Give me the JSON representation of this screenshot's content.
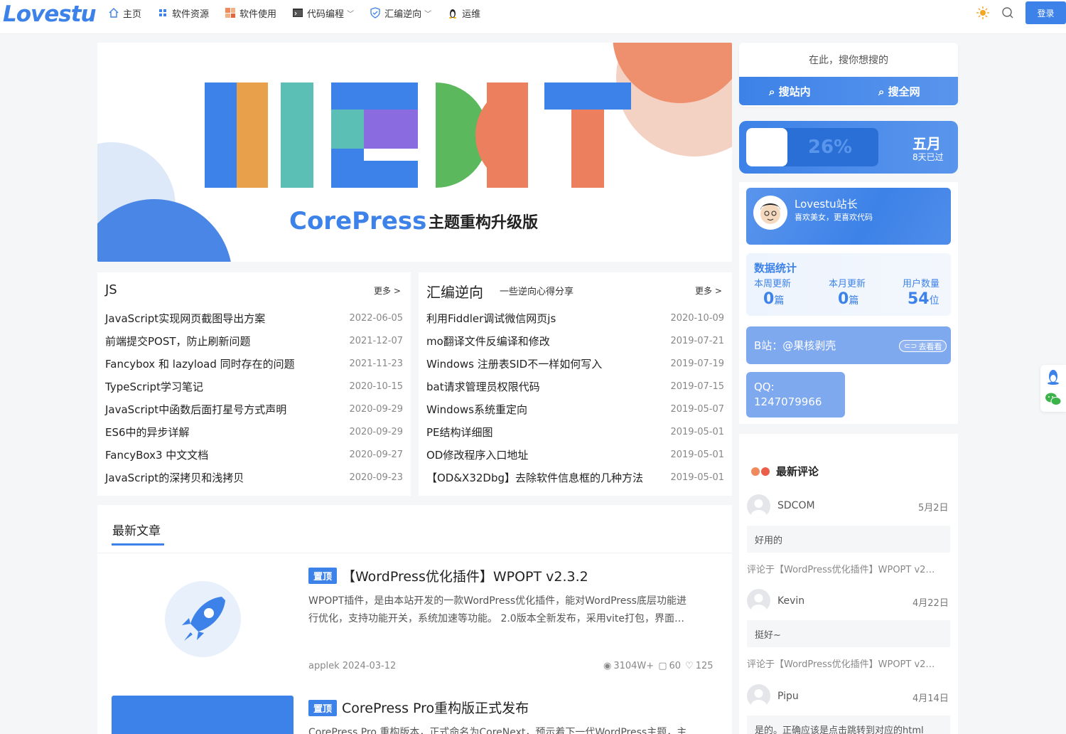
{
  "header": {
    "logo": "Lovestu",
    "nav": [
      {
        "label": "主页",
        "icon": "home-icon"
      },
      {
        "label": "软件资源",
        "icon": "grid-icon"
      },
      {
        "label": "软件使用",
        "icon": "apps-color-icon"
      },
      {
        "label": "代码编程",
        "icon": "terminal-icon",
        "dropdown": true
      },
      {
        "label": "汇编逆向",
        "icon": "shield-icon",
        "dropdown": true
      },
      {
        "label": "运维",
        "icon": "linux-icon"
      }
    ],
    "login": "登录"
  },
  "banner": {
    "brand": "CorePress",
    "sub": "主题重构升级版",
    "word": "NEXT"
  },
  "js_card": {
    "title": "JS",
    "more": "更多 >",
    "items": [
      {
        "t": "JavaScript实现网页截图导出方案",
        "d": "2022-06-05"
      },
      {
        "t": "前端提交POST，防止刷新问题",
        "d": "2021-12-07"
      },
      {
        "t": "Fancybox 和 lazyload 同时存在的问题",
        "d": "2021-11-23"
      },
      {
        "t": "TypeScript学习笔记",
        "d": "2020-10-15"
      },
      {
        "t": "JavaScript中函数后面打星号方式声明",
        "d": "2020-09-29"
      },
      {
        "t": "ES6中的异步详解",
        "d": "2020-09-29"
      },
      {
        "t": "FancyBox3 中文文档",
        "d": "2020-09-27"
      },
      {
        "t": "JavaScript的深拷贝和浅拷贝",
        "d": "2020-09-23"
      }
    ]
  },
  "asm_card": {
    "title": "汇编逆向",
    "subtitle": "一些逆向心得分享",
    "more": "更多 >",
    "items": [
      {
        "t": "利用Fiddler调试微信网页js",
        "d": "2020-10-09"
      },
      {
        "t": "mo翻译文件反编译和修改",
        "d": "2019-07-21"
      },
      {
        "t": "Windows 注册表SID不一样如何写入",
        "d": "2019-07-19"
      },
      {
        "t": "bat请求管理员权限代码",
        "d": "2019-07-15"
      },
      {
        "t": "Windows系统重定向",
        "d": "2019-05-07"
      },
      {
        "t": "PE结构详细图",
        "d": "2019-05-01"
      },
      {
        "t": "OD修改程序入口地址",
        "d": "2019-05-01"
      },
      {
        "t": "【OD&X32Dbg】去除软件信息框的几种方法",
        "d": "2019-05-01"
      }
    ]
  },
  "latest": {
    "title": "最新文章",
    "posts": [
      {
        "tag": "置顶",
        "title": "【WordPress优化插件】WPOPT v2.3.2",
        "excerpt1": "WPOPT插件，是由本站开发的一款WordPress优化插件，能对WordPress底层功能进",
        "excerpt2": "行优化，支持功能开关，系统加速等功能。 2.0版本全新发布，采用vite打包，界面…",
        "meta": "applek 2024-03-12",
        "views": "3104W+",
        "comments": "60",
        "likes": "125"
      },
      {
        "tag": "置顶",
        "title": "CorePress Pro重构版正式发布",
        "excerpt1": "CorePress Pro 重构版本，正式命名为CoreNext，预示着下一代WordPress主题，主"
      }
    ]
  },
  "sidebar": {
    "search": {
      "placeholder": "在此，搜你想搜的",
      "btn_site": "搜站内",
      "btn_all": "搜全网"
    },
    "progress": {
      "percent_label": "26%",
      "fraction": 0.26,
      "month": "五月",
      "days": "8天已过"
    },
    "profile": {
      "name": "Lovestu站长",
      "bio": "喜欢美女，更喜欢代码"
    },
    "stats": {
      "title": "数据统计",
      "items": [
        {
          "label": "本周更新",
          "value": "0",
          "unit": "篇"
        },
        {
          "label": "本月更新",
          "value": "0",
          "unit": "篇"
        },
        {
          "label": "用户数量",
          "value": "54",
          "unit": "位"
        }
      ]
    },
    "bili": {
      "text": "B站：@果核剥壳",
      "btn": "去看看"
    },
    "qq": {
      "label": "QQ:",
      "number": "1247079966"
    },
    "comments": {
      "title": "最新评论",
      "items": [
        {
          "user": "SDCOM",
          "date": "5月2日",
          "body": "好用的",
          "ref": "评论于【WordPress优化插件】WPOPT v2…"
        },
        {
          "user": "Kevin",
          "date": "4月22日",
          "body": "挺好~",
          "ref": "评论于【WordPress优化插件】WPOPT v2…"
        },
        {
          "user": "Pipu",
          "date": "4月14日",
          "body": "是的。正确应该是点击跳转到对应的html"
        }
      ]
    }
  },
  "colors": {
    "accent": "#3d82e8",
    "next_orange": "#e8a04a",
    "next_teal": "#5bbfb5",
    "next_purple": "#8b6be0",
    "next_green": "#5cb85c",
    "next_coral": "#eb7f5e"
  }
}
